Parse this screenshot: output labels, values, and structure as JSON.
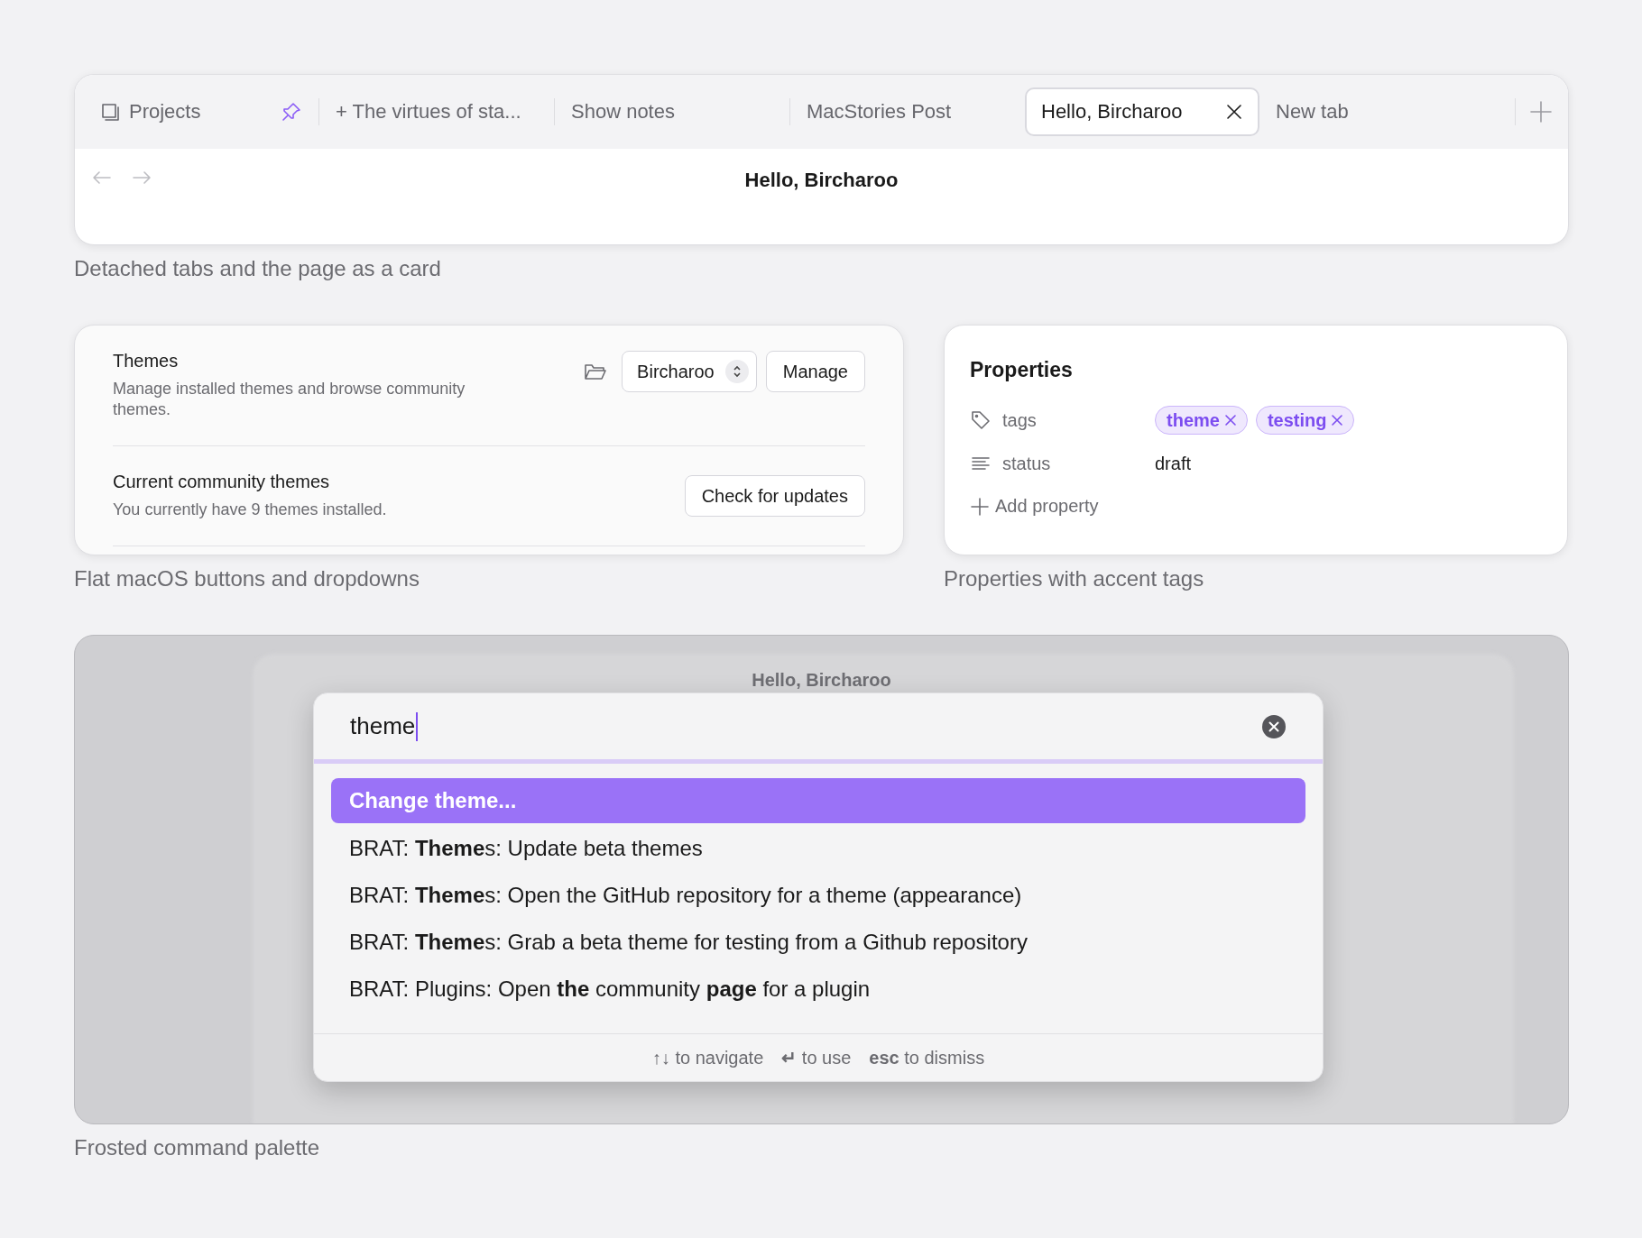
{
  "tab_card": {
    "tabs": [
      {
        "label": "Projects",
        "kind": "pinned",
        "selected": false
      },
      {
        "label": "+ The virtues of sta...",
        "kind": "normal",
        "selected": false
      },
      {
        "label": "Show notes",
        "kind": "normal",
        "selected": false
      },
      {
        "label": "MacStories Post",
        "kind": "normal",
        "selected": false
      },
      {
        "label": "Hello, Bircharoo",
        "kind": "normal",
        "selected": true
      },
      {
        "label": "New tab",
        "kind": "normal",
        "selected": false
      }
    ],
    "page_title": "Hello, Bircharoo",
    "caption": "Detached tabs and the page as a card"
  },
  "settings_card": {
    "rows": [
      {
        "title": "Themes",
        "description": "Manage installed themes and browse community themes.",
        "dropdown": "Bircharoo",
        "buttons": [
          "Manage"
        ]
      },
      {
        "title": "Current community themes",
        "description": "You currently have 9 themes installed.",
        "buttons": [
          "Check for updates"
        ]
      }
    ],
    "caption": "Flat macOS buttons and dropdowns"
  },
  "properties_card": {
    "title": "Properties",
    "properties": [
      {
        "kind": "tags",
        "name": "tags",
        "tags": [
          "theme",
          "testing"
        ]
      },
      {
        "kind": "text",
        "name": "status",
        "value": "draft"
      }
    ],
    "add_label": "Add property",
    "caption": "Properties with accent tags"
  },
  "palette_card": {
    "background_title": "Hello, Bircharoo",
    "query": "theme",
    "items": [
      {
        "text": "**Change theme...**",
        "selected": true
      },
      {
        "text": "BRAT: **Theme**s: Update beta themes",
        "selected": false
      },
      {
        "text": "BRAT: **Theme**s: Open the GitHub repository for a theme (appearance)",
        "selected": false
      },
      {
        "text": "BRAT: **Theme**s: Grab a beta theme for testing from a Github repository",
        "selected": false
      },
      {
        "text": "BRAT: Plugins: Open **the** community **page** for a plugin",
        "selected": false
      }
    ],
    "hints": [
      {
        "key": "↑↓",
        "label": "to navigate"
      },
      {
        "key": "↵",
        "label": "to use"
      },
      {
        "key": "esc",
        "label": "to dismiss"
      }
    ],
    "caption": "Frosted command palette"
  }
}
